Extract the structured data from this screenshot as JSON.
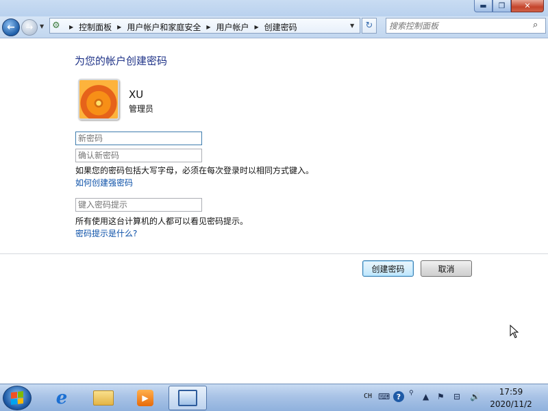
{
  "window": {
    "min_glyph": "▬",
    "max_glyph": "❐",
    "close_glyph": "✕"
  },
  "navbar": {
    "back_glyph": "←",
    "forward_glyph": "→",
    "breadcrumbs": [
      "控制面板",
      "用户帐户和家庭安全",
      "用户帐户",
      "创建密码"
    ],
    "crumb_separator": "▶",
    "refresh_glyph": "↻",
    "search_placeholder": "搜索控制面板"
  },
  "main": {
    "title": "为您的帐户创建密码",
    "user": {
      "name": "XU",
      "role": "管理员"
    },
    "fields": {
      "new_password_placeholder": "新密码",
      "confirm_password_placeholder": "确认新密码",
      "hint_placeholder": "键入密码提示"
    },
    "caps_note": "如果您的密码包括大写字母，必须在每次登录时以相同方式键入。",
    "strong_password_link": "如何创建强密码",
    "hint_note": "所有使用这台计算机的人都可以看见密码提示。",
    "what_is_hint_link": "密码提示是什么?",
    "buttons": {
      "create": "创建密码",
      "cancel": "取消"
    }
  },
  "taskbar": {
    "language": "CH",
    "help_glyph": "?",
    "clock_time": "17:59",
    "clock_date": "2020/11/2"
  },
  "colors": {
    "title_blue": "#1e3287",
    "link_blue": "#0b50a8"
  }
}
